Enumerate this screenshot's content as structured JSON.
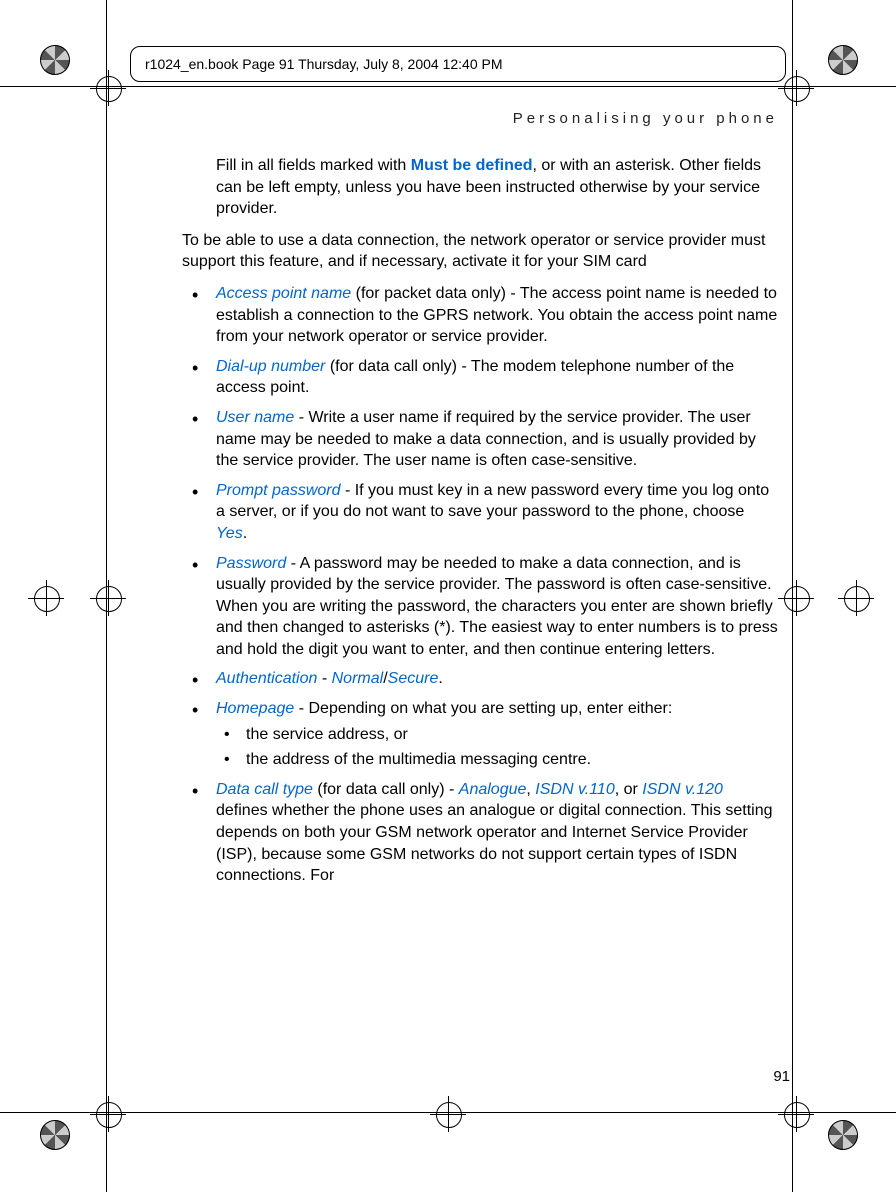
{
  "header": {
    "strip_text": "r1024_en.book  Page 91  Thursday, July 8, 2004  12:40 PM"
  },
  "section_heading": "Personalising your phone",
  "intro_para_pre": "Fill in all fields marked with ",
  "intro_highlight": "Must be defined",
  "intro_para_post": ", or with an asterisk. Other fields can be left empty, unless you have been instructed otherwise by your service provider.",
  "para2": "To be able to use a data connection, the network operator or service provider must support this feature, and if necessary, activate it for your SIM card",
  "bullets": [
    {
      "term": "Access point name",
      "text": " (for packet data only) - The access point name is needed to establish a connection to the GPRS network. You obtain the access point name from your network operator or service provider."
    },
    {
      "term": "Dial-up number",
      "text": " (for data call only) - The modem telephone number of the access point."
    },
    {
      "term": "User name",
      "text": " - Write a user name if required by the service provider. The user name may be needed to make a data connection, and is usually provided by the service provider. The user name is often case-sensitive."
    },
    {
      "term": "Prompt password",
      "text_pre": " - If you must key in a new password every time you log onto a server, or if you do not want to save your password to the phone, choose ",
      "opt": "Yes",
      "text_post": "."
    },
    {
      "term": "Password",
      "text": " - A password may be needed to make a data connection, and is usually provided by the service provider. The password is often case-sensitive. When you are writing the password, the characters you enter are shown briefly and then changed to asterisks (*). The easiest way to enter numbers is to press and hold the digit you want to enter, and then continue entering letters."
    },
    {
      "term": "Authentication",
      "text_pre": " - ",
      "opt1": "Normal",
      "sep": "/",
      "opt2": "Secure",
      "text_post": "."
    },
    {
      "term": "Homepage",
      "text": " - Depending on what you are setting up, enter either:",
      "sub": [
        "the service address, or",
        "the address of the multimedia messaging centre."
      ]
    },
    {
      "term": "Data call type",
      "text_pre": " (for data call only) - ",
      "opt1": "Analogue",
      "sep1": ", ",
      "opt2": "ISDN v.110",
      "sep2": ", or ",
      "opt3": "ISDN v.120",
      "text_post": " defines whether the phone uses an analogue or digital connection. This setting depends on both your GSM network operator and Internet Service Provider (ISP), because some GSM networks do not support certain types of ISDN connections. For"
    }
  ],
  "page_number": "91"
}
